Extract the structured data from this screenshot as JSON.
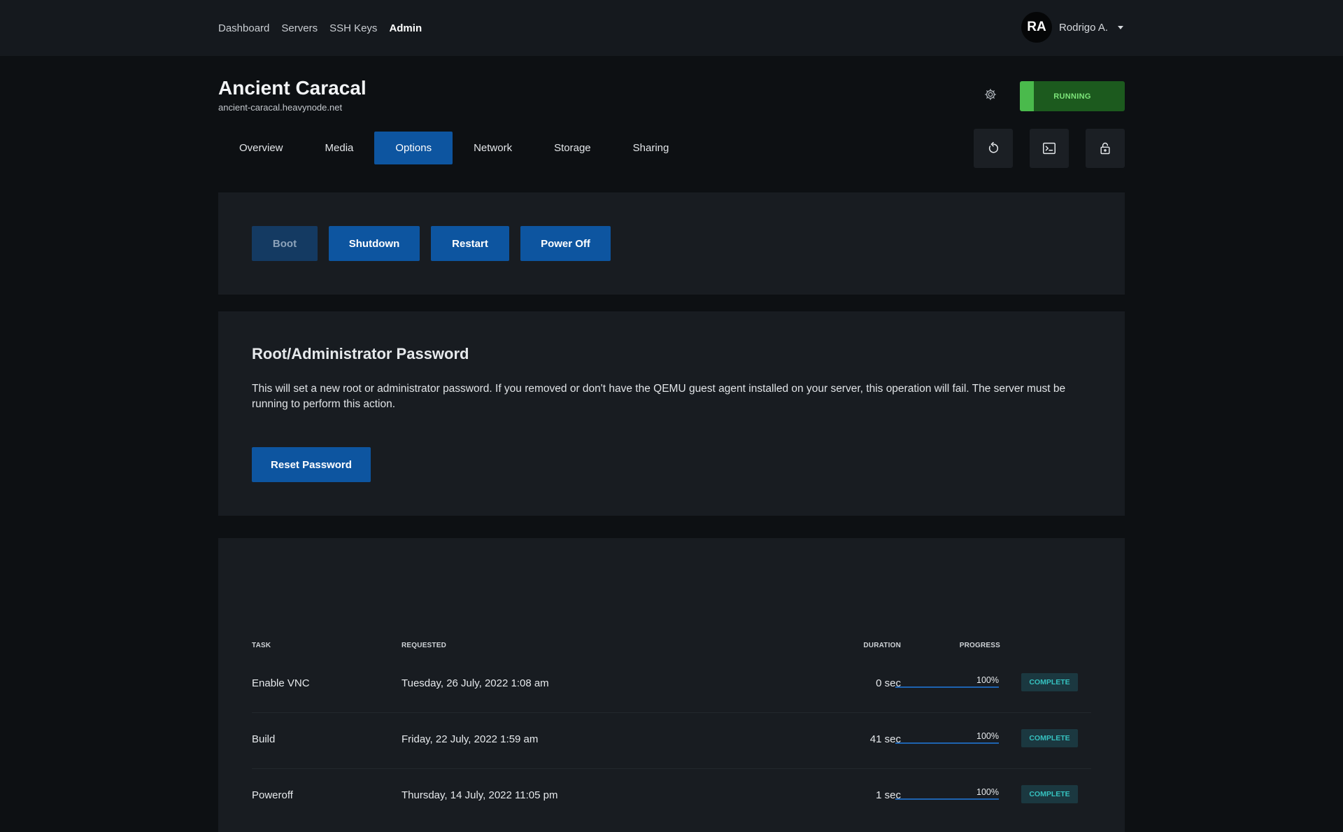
{
  "nav": {
    "items": [
      {
        "label": "Dashboard",
        "active": false
      },
      {
        "label": "Servers",
        "active": false
      },
      {
        "label": "SSH Keys",
        "active": false
      },
      {
        "label": "Admin",
        "active": true
      }
    ]
  },
  "user": {
    "initials": "RA",
    "name": "Rodrigo A."
  },
  "server": {
    "name": "Ancient Caracal",
    "hostname": "ancient-caracal.heavynode.net",
    "status": "RUNNING"
  },
  "tabs": [
    {
      "label": "Overview",
      "active": false
    },
    {
      "label": "Media",
      "active": false
    },
    {
      "label": "Options",
      "active": true
    },
    {
      "label": "Network",
      "active": false
    },
    {
      "label": "Storage",
      "active": false
    },
    {
      "label": "Sharing",
      "active": false
    }
  ],
  "actions": {
    "icons": [
      "restart-icon",
      "console-icon",
      "lock-icon"
    ]
  },
  "power": {
    "boot": "Boot",
    "shutdown": "Shutdown",
    "restart": "Restart",
    "poweroff": "Power Off"
  },
  "password": {
    "title": "Root/Administrator Password",
    "description": "This will set a new root or administrator password. If you removed or don't have the QEMU guest agent installed on your server, this operation will fail. The server must be running to perform this action.",
    "button": "Reset Password"
  },
  "tasks": {
    "headers": {
      "task": "TASK",
      "requested": "REQUESTED",
      "duration": "DURATION",
      "progress": "PROGRESS"
    },
    "rows": [
      {
        "task": "Enable VNC",
        "requested": "Tuesday, 26 July, 2022 1:08 am",
        "duration": "0 sec",
        "progress": "100%",
        "progress_value": 100,
        "status": "COMPLETE"
      },
      {
        "task": "Build",
        "requested": "Friday, 22 July, 2022 1:59 am",
        "duration": "41 sec",
        "progress": "100%",
        "progress_value": 100,
        "status": "COMPLETE"
      },
      {
        "task": "Poweroff",
        "requested": "Thursday, 14 July, 2022 11:05 pm",
        "duration": "1 sec",
        "progress": "100%",
        "progress_value": 100,
        "status": "COMPLETE"
      }
    ]
  },
  "colors": {
    "accent": "#0d55a0",
    "running_bg": "#1c5a1e",
    "running_text": "#7de57a",
    "complete_text": "#36c2c0"
  }
}
